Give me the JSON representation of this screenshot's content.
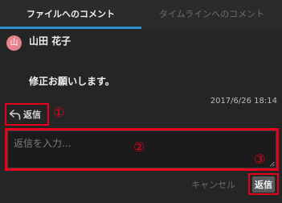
{
  "tabs": [
    {
      "label": "ファイルへのコメント",
      "active": true
    },
    {
      "label": "タイムラインへのコメント",
      "active": false
    }
  ],
  "comment": {
    "avatar_initial": "山",
    "author": "山田 花子",
    "body": "修正お願いします。",
    "timestamp": "2017/6/26 18:14"
  },
  "reply": {
    "link_label": "返信",
    "link_icon": "reply-arrow-icon",
    "input_placeholder": "返信を入力...",
    "cancel_label": "キャンセル",
    "submit_label": "返信"
  },
  "annotations": {
    "marker_1": "①",
    "marker_2": "②",
    "marker_3": "③"
  },
  "colors": {
    "background": "#252525",
    "tab_accent": "#2c8fd0",
    "annotation_red": "#e8001c",
    "avatar": "#e6838e"
  }
}
